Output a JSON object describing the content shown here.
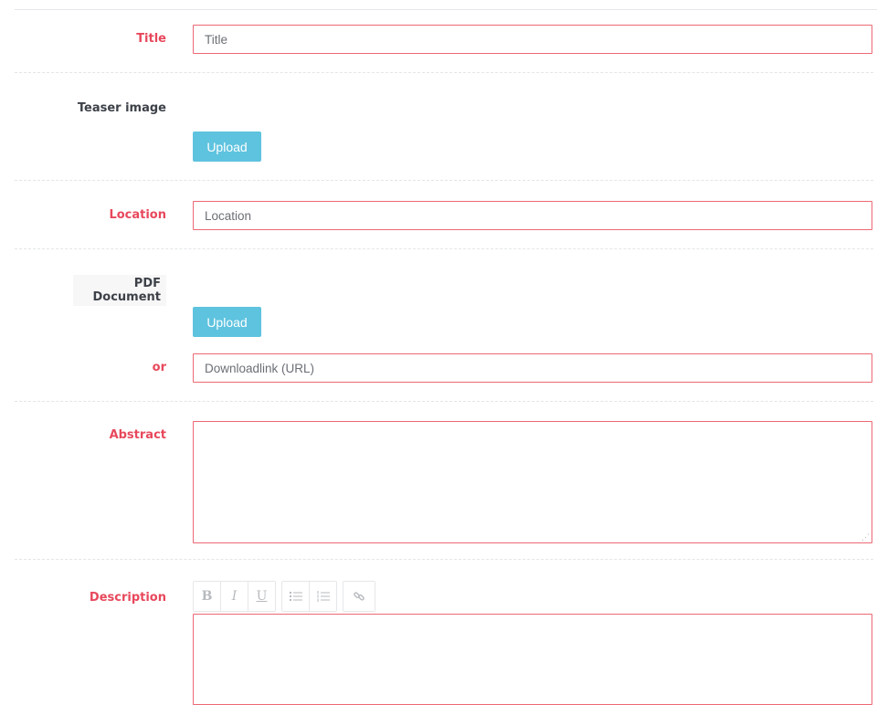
{
  "form": {
    "title": {
      "label": "Title",
      "placeholder": "Title"
    },
    "teaser_image": {
      "label": "Teaser image",
      "upload_label": "Upload"
    },
    "location": {
      "label": "Location",
      "placeholder": "Location"
    },
    "pdf_document": {
      "label": "PDF Document",
      "upload_label": "Upload",
      "or_label": "or",
      "url_placeholder": "Downloadlink (URL)"
    },
    "abstract": {
      "label": "Abstract"
    },
    "description": {
      "label": "Description",
      "toolbar": {
        "bold": "B",
        "italic": "I",
        "underline": "U",
        "bullet_list_icon": "bullet-list-icon",
        "numbered_list_icon": "numbered-list-icon",
        "link_icon": "link-icon"
      }
    }
  },
  "colors": {
    "required_label": "#e8485c",
    "input_border": "#ec6874",
    "upload_button": "#5ec3df"
  }
}
